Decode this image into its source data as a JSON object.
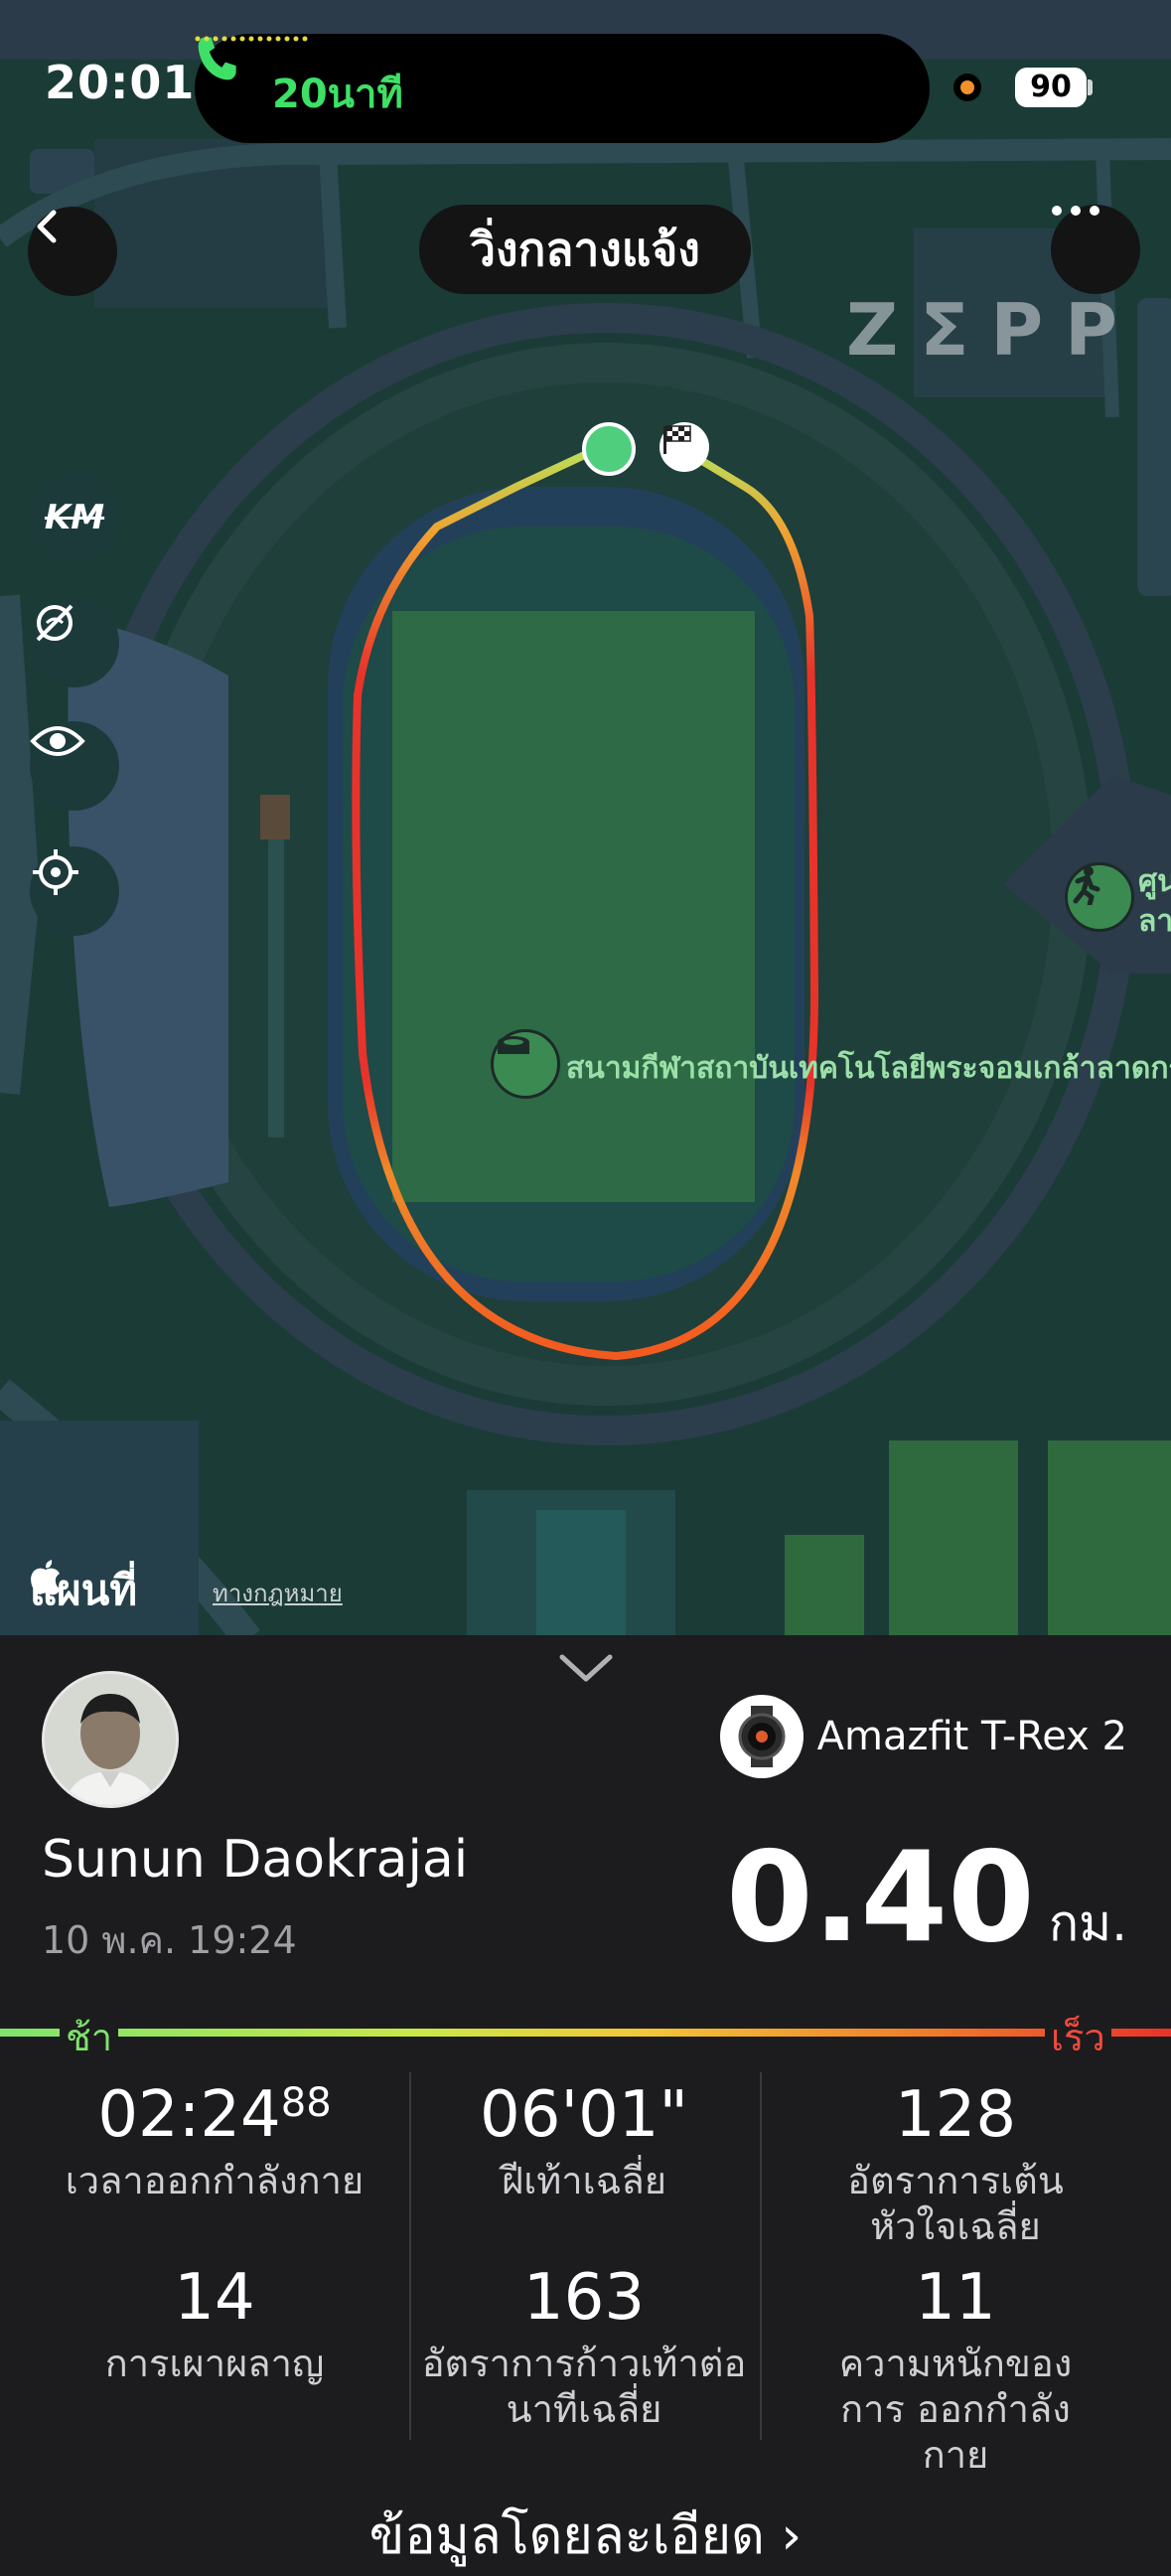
{
  "status_bar": {
    "time": "20:01",
    "call_duration": "20นาที",
    "battery": "90"
  },
  "map": {
    "title": "วิ่งกลางแจ้ง",
    "watermark": "ZΣPP",
    "poi_label": "สนามกีฬาสถาบันเทคโนโลยีพระจอมเกล้าลาดกระบัง",
    "side_poi_label_line1": "ศูน",
    "side_poi_label_line2": "ลา",
    "attribution": "แผนที่",
    "legal": "ทางกฎหมาย",
    "side_controls": [
      "km-icon",
      "hide-icon",
      "eye-icon",
      "locate-icon"
    ],
    "side_controls_text": {
      "km": "KM"
    }
  },
  "workout": {
    "user_name": "Sunun Daokrajai",
    "date": "10 พ.ค. 19:24",
    "device": "Amazfit T-Rex 2",
    "distance": "0.40",
    "distance_unit": "กม.",
    "pace_scale": {
      "slow": "ช้า",
      "fast": "เร็ว"
    },
    "stats": [
      {
        "value": "02:24",
        "value_suffix": "88",
        "label": "เวลาออกกำลังกาย"
      },
      {
        "value": "06'01\"",
        "label": "ฝีเท้าเฉลี่ย"
      },
      {
        "value": "128",
        "label": "อัตราการเต้น หัวใจเฉลี่ย"
      },
      {
        "value": "14",
        "label": "การเผาผลาญ"
      },
      {
        "value": "163",
        "label": "อัตราการก้าวเท้าต่อ นาทีเฉลี่ย"
      },
      {
        "value": "11",
        "label": "ความหนักของการ ออกกำลังกาย"
      }
    ],
    "details_link": "ข้อมูลโดยละเอียด ›"
  },
  "colors": {
    "map_bg": "#1b3b37",
    "route_slow": "#e8332a",
    "route_fast": "#7ee36c",
    "call_green": "#3ee066"
  }
}
